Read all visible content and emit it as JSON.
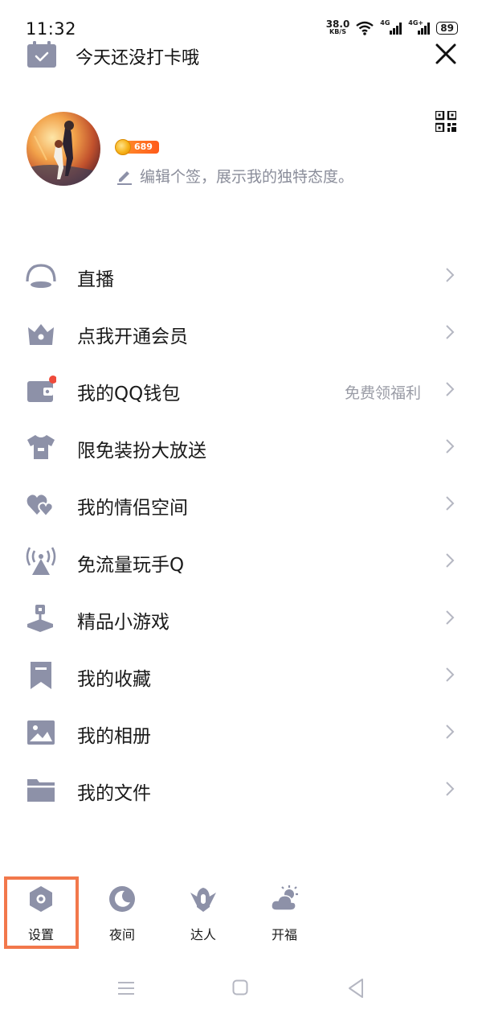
{
  "status_bar": {
    "time": "11:32",
    "net_speed": "38.0",
    "net_speed_unit": "KB/S",
    "signal1_label": "4G",
    "signal2_label": "4G+",
    "battery": "89"
  },
  "header": {
    "checkin_text": "今天还没打卡哦"
  },
  "profile": {
    "level": "689",
    "signature_placeholder": "编辑个签，展示我的独特态度。"
  },
  "menu": [
    {
      "label": "直播",
      "icon": "live-icon",
      "hint": ""
    },
    {
      "label": "点我开通会员",
      "icon": "crown-icon",
      "hint": ""
    },
    {
      "label": "我的QQ钱包",
      "icon": "wallet-icon",
      "hint": "免费领福利",
      "badge_dot": true
    },
    {
      "label": "限免装扮大放送",
      "icon": "tshirt-icon",
      "hint": ""
    },
    {
      "label": "我的情侣空间",
      "icon": "hearts-icon",
      "hint": ""
    },
    {
      "label": "免流量玩手Q",
      "icon": "signal-tower-icon",
      "hint": ""
    },
    {
      "label": "精品小游戏",
      "icon": "joystick-icon",
      "hint": ""
    },
    {
      "label": "我的收藏",
      "icon": "bookmark-icon",
      "hint": ""
    },
    {
      "label": "我的相册",
      "icon": "photo-icon",
      "hint": ""
    },
    {
      "label": "我的文件",
      "icon": "folder-icon",
      "hint": ""
    }
  ],
  "bottom": [
    {
      "label": "设置",
      "icon": "settings-icon"
    },
    {
      "label": "夜间",
      "icon": "moon-icon"
    },
    {
      "label": "达人",
      "icon": "talent-icon"
    },
    {
      "label": "开福",
      "icon": "weather-icon"
    }
  ],
  "colors": {
    "icon": "#8d91a8",
    "accent_highlight": "#f2784b",
    "text": "#1a1a1a",
    "muted": "#9a9ca6"
  }
}
